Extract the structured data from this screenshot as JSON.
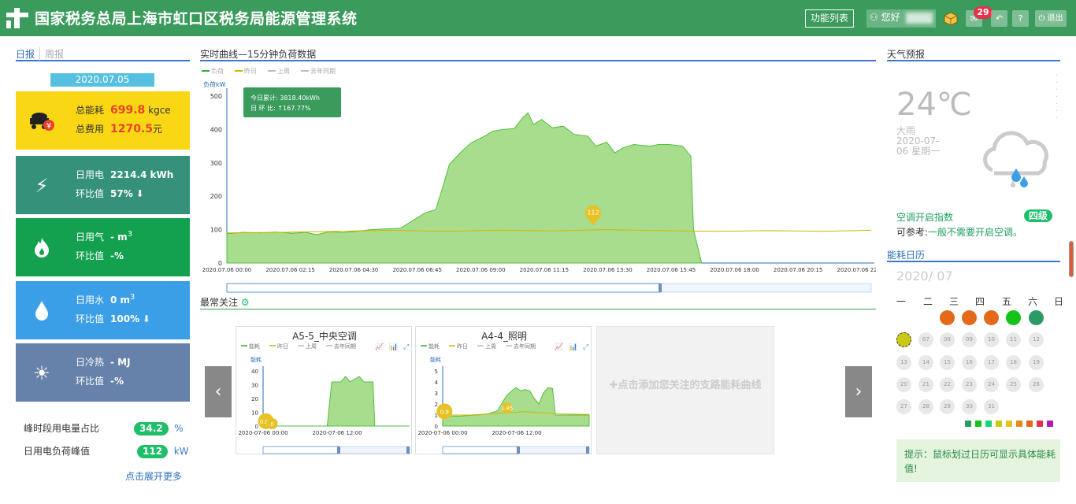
{
  "header": {
    "title": "国家税务总局上海市虹口区税务局能源管理系统",
    "func_list": "功能列表",
    "greeting": "您好",
    "message_count": "29",
    "logout": "退出",
    "help": "?"
  },
  "left": {
    "tab_daily": "日报",
    "tab_weekly": "周报",
    "date": "2020.07.05",
    "total": {
      "energy_label": "总能耗",
      "energy_value": "699.8",
      "energy_unit": "kgce",
      "cost_label": "总费用",
      "cost_value": "1270.5",
      "cost_unit": "元"
    },
    "elec": {
      "label": "日用电",
      "value": "2214.4 kWh",
      "ratio_label": "环比值",
      "ratio_value": "57%"
    },
    "gas": {
      "label": "日用气",
      "value": "- m",
      "sup": "3",
      "ratio_label": "环比值",
      "ratio_value": "-%"
    },
    "water": {
      "label": "日用水",
      "value": "0 m",
      "sup": "3",
      "ratio_label": "环比值",
      "ratio_value": "100%"
    },
    "cold": {
      "label": "日冷热",
      "value": "- MJ",
      "ratio_label": "环比值",
      "ratio_value": "-%"
    },
    "peak_ratio_label": "峰时段用电量占比",
    "peak_ratio_value": "34.2",
    "peak_ratio_unit": "%",
    "peak_load_label": "日用电负荷峰值",
    "peak_load_value": "112",
    "peak_load_unit": "kW",
    "more": "点击展开更多"
  },
  "middle": {
    "realtime_title": "实时曲线—15分钟负荷数据",
    "favorites_title": "最常关注",
    "add_hint": "点击添加您关注的支路能耗曲线"
  },
  "right": {
    "weather_title": "天气预报",
    "temperature": "24℃",
    "weather": "大雨",
    "date_line1": "2020-07-",
    "date_line2": "06 星期一",
    "ac_label": "空调开启指数",
    "ac_level": "四级",
    "ac_hint_prefix": "可参考:",
    "ac_hint": "一般不需要开启空调。",
    "calendar_title": "能耗日历",
    "calendar_month": "2020/ 07",
    "weekdays": [
      "一",
      "二",
      "三",
      "四",
      "五",
      "六",
      "日"
    ],
    "tip": "提示：鼠标划过日历可显示具体能耗值!"
  },
  "colors": {
    "header": "#3a9b5c",
    "accent": "#3a78c8",
    "green": "#1fbf6a"
  },
  "chart_data": [
    {
      "type": "area",
      "title": "",
      "ylabel": "负荷kW",
      "legend": [
        "负荷",
        "昨日",
        "上周",
        "去年同期"
      ],
      "ylim": [
        0,
        500
      ],
      "yticks": [
        0,
        100,
        200,
        300,
        400,
        500
      ],
      "xticks": [
        "2020.07.06 00:00",
        "2020.07.06 02:15",
        "2020.07.06 04:30",
        "2020.07.06 06:45",
        "2020.07.06 09:00",
        "2020.07.06 11:15",
        "2020.07.06 13:30",
        "2020.07.06 15:45",
        "2020.07.06 18:00",
        "2020.07.06 20:15",
        "2020.07.06 22:30"
      ],
      "series": [
        {
          "name": "负荷",
          "points": [
            [
              0,
              88
            ],
            [
              0.6,
              92
            ],
            [
              1.2,
              90
            ],
            [
              1.8,
              93
            ],
            [
              2.4,
              89
            ],
            [
              2.9,
              92
            ],
            [
              3.3,
              85
            ],
            [
              3.8,
              94
            ],
            [
              4.3,
              91
            ],
            [
              4.8,
              95
            ],
            [
              5.3,
              100
            ],
            [
              5.8,
              102
            ],
            [
              6.4,
              104
            ],
            [
              7.3,
              150
            ],
            [
              7.7,
              160
            ],
            [
              7.95,
              225
            ],
            [
              8.2,
              295
            ],
            [
              8.6,
              330
            ],
            [
              9.0,
              360
            ],
            [
              9.5,
              380
            ],
            [
              9.8,
              395
            ],
            [
              10.2,
              400
            ],
            [
              10.6,
              403
            ],
            [
              10.9,
              435
            ],
            [
              11.1,
              450
            ],
            [
              11.3,
              415
            ],
            [
              11.6,
              430
            ],
            [
              12.0,
              405
            ],
            [
              12.4,
              410
            ],
            [
              12.8,
              385
            ],
            [
              13.3,
              380
            ],
            [
              13.6,
              350
            ],
            [
              14.0,
              362
            ],
            [
              14.3,
              330
            ],
            [
              14.6,
              345
            ],
            [
              15.0,
              355
            ],
            [
              15.6,
              350
            ],
            [
              15.9,
              355
            ],
            [
              16.3,
              355
            ],
            [
              16.8,
              350
            ],
            [
              17.1,
              320
            ],
            [
              17.2,
              100
            ],
            [
              17.5,
              0
            ]
          ]
        },
        {
          "name": "昨日",
          "points": [
            [
              0,
              90
            ],
            [
              2,
              92
            ],
            [
              4,
              95
            ],
            [
              6,
              98
            ],
            [
              8,
              95
            ],
            [
              10,
              98
            ],
            [
              12,
              96
            ],
            [
              14,
              100
            ],
            [
              16,
              97
            ],
            [
              18,
              95
            ],
            [
              20,
              97
            ],
            [
              22,
              95
            ],
            [
              23.75,
              98
            ]
          ]
        }
      ],
      "annotations": [
        {
          "label": "112",
          "x": 13.5,
          "y": 112
        }
      ],
      "tooltip": {
        "today_total_label": "今日累计:",
        "today_total": "3818.40kWh",
        "ratio_label": "日 环 比:",
        "ratio": "↑167.77%"
      }
    },
    {
      "type": "area",
      "title": "A5-5_中央空调",
      "ylabel": "能耗",
      "legend": [
        "能耗",
        "昨日",
        "上周",
        "去年同期"
      ],
      "ylim": [
        0,
        40
      ],
      "yticks": [
        0,
        10,
        20,
        30,
        40
      ],
      "xticks": [
        "2020-07-06 00:00",
        "2020-07-06 12:00"
      ],
      "series": [
        {
          "name": "能耗",
          "points": [
            [
              0,
              0
            ],
            [
              7,
              0
            ],
            [
              7.5,
              32
            ],
            [
              8.5,
              32
            ],
            [
              9,
              36
            ],
            [
              9.5,
              32
            ],
            [
              10.5,
              36
            ],
            [
              11,
              32
            ],
            [
              12,
              32
            ],
            [
              12.2,
              0
            ],
            [
              16,
              0
            ]
          ]
        }
      ],
      "annotations": [
        {
          "label": "0.08",
          "x": 0.3,
          "y": 0.08
        },
        {
          "label": "0",
          "x": 1.0,
          "y": 0
        }
      ]
    },
    {
      "type": "area",
      "title": "A4-4_照明",
      "ylabel": "能耗",
      "legend": [
        "能耗",
        "昨日",
        "上周",
        "去年同期"
      ],
      "ylim": [
        0,
        5
      ],
      "yticks": [
        0,
        1,
        2,
        3,
        4,
        5
      ],
      "xticks": [
        "2020-07-06 00:00",
        "2020-07-06 12:00"
      ],
      "series": [
        {
          "name": "能耗",
          "points": [
            [
              0,
              0.9
            ],
            [
              2,
              0.9
            ],
            [
              5,
              1.1
            ],
            [
              6,
              1.4
            ],
            [
              7,
              2.8
            ],
            [
              8,
              3.5
            ],
            [
              8.5,
              3.2
            ],
            [
              9,
              3.3
            ],
            [
              9.5,
              3.2
            ],
            [
              10,
              2.5
            ],
            [
              10.5,
              2.0
            ],
            [
              11,
              3.0
            ],
            [
              11.5,
              3.5
            ],
            [
              12,
              3.4
            ],
            [
              12.3,
              1.0
            ],
            [
              16,
              1.0
            ]
          ]
        },
        {
          "name": "昨日",
          "points": [
            [
              0,
              1.0
            ],
            [
              3,
              1.0
            ],
            [
              5,
              1.1
            ],
            [
              7,
              1.2
            ],
            [
              9,
              1.3
            ],
            [
              11,
              1.2
            ],
            [
              13,
              1.1
            ],
            [
              16,
              1.05
            ]
          ]
        }
      ],
      "annotations": [
        {
          "label": "0.9",
          "x": 0.2,
          "y": 0.9
        },
        {
          "label": "1.45",
          "x": 7.0,
          "y": 1.45
        }
      ]
    }
  ]
}
